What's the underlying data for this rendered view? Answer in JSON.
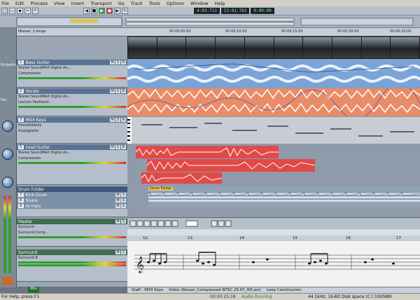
{
  "menu": [
    "File",
    "Edit",
    "Process",
    "View",
    "Insert",
    "Transport",
    "Go",
    "Track",
    "Tools",
    "Options",
    "Window",
    "Help"
  ],
  "transport": {
    "time_now": "4:03:713",
    "time_smpte": "12:01:763",
    "time_end": "0:00:00"
  },
  "tracks": [
    {
      "num": "1",
      "name": "Bass Guitar",
      "out": "Stereo SoundMAX Digital Au...",
      "fx": "Compression"
    },
    {
      "num": "2",
      "name": "Vocals",
      "out": "Stereo SoundMAX Digital Au...",
      "fx": "Lexicon Pantheon"
    },
    {
      "num": "3",
      "name": "MIDI Keys",
      "out": "HomeAddelia",
      "fx": "Arpeggiator"
    },
    {
      "num": "5",
      "name": "Lead Guitar",
      "out": "Stereo SoundMAX Digital Au...",
      "fx": "Compression"
    },
    {
      "num": "",
      "name": "Drum Folder",
      "out": "",
      "fx": ""
    },
    {
      "num": "7",
      "name": "Kick Drum",
      "out": "",
      "fx": ""
    },
    {
      "num": "8",
      "name": "Snare",
      "out": "",
      "fx": ""
    },
    {
      "num": "9",
      "name": "Hi-Hats",
      "out": "",
      "fx": ""
    },
    {
      "num": "",
      "name": "Master",
      "out": "Surround",
      "fx": "Surround Comp..."
    },
    {
      "num": "",
      "name": "Surround",
      "out": "Surround B",
      "fx": ""
    }
  ],
  "ruler": [
    "00:00:05:00",
    "00:00:10:00",
    "00:00:15:00",
    "00:00:20:00",
    "00:00:25:00"
  ],
  "title_clip": "Nissan_Comps",
  "clips": {
    "drum": "Drum Folder"
  },
  "staff": {
    "bars": [
      "12",
      "13",
      "14",
      "15",
      "16",
      "17"
    ]
  },
  "tabs": [
    "Staff - MIDI Keys",
    "Video (Nissan_Compressed NTSC 29.97_HD.avi)",
    "Loop Construction"
  ],
  "mix_tab": "Mix",
  "status": {
    "help": "For Help, press F1",
    "time": "00:00:25:18",
    "running": "Audio Running",
    "disk": "44.1kHz, 16-Bit  Disk space (C:) 10058M"
  }
}
